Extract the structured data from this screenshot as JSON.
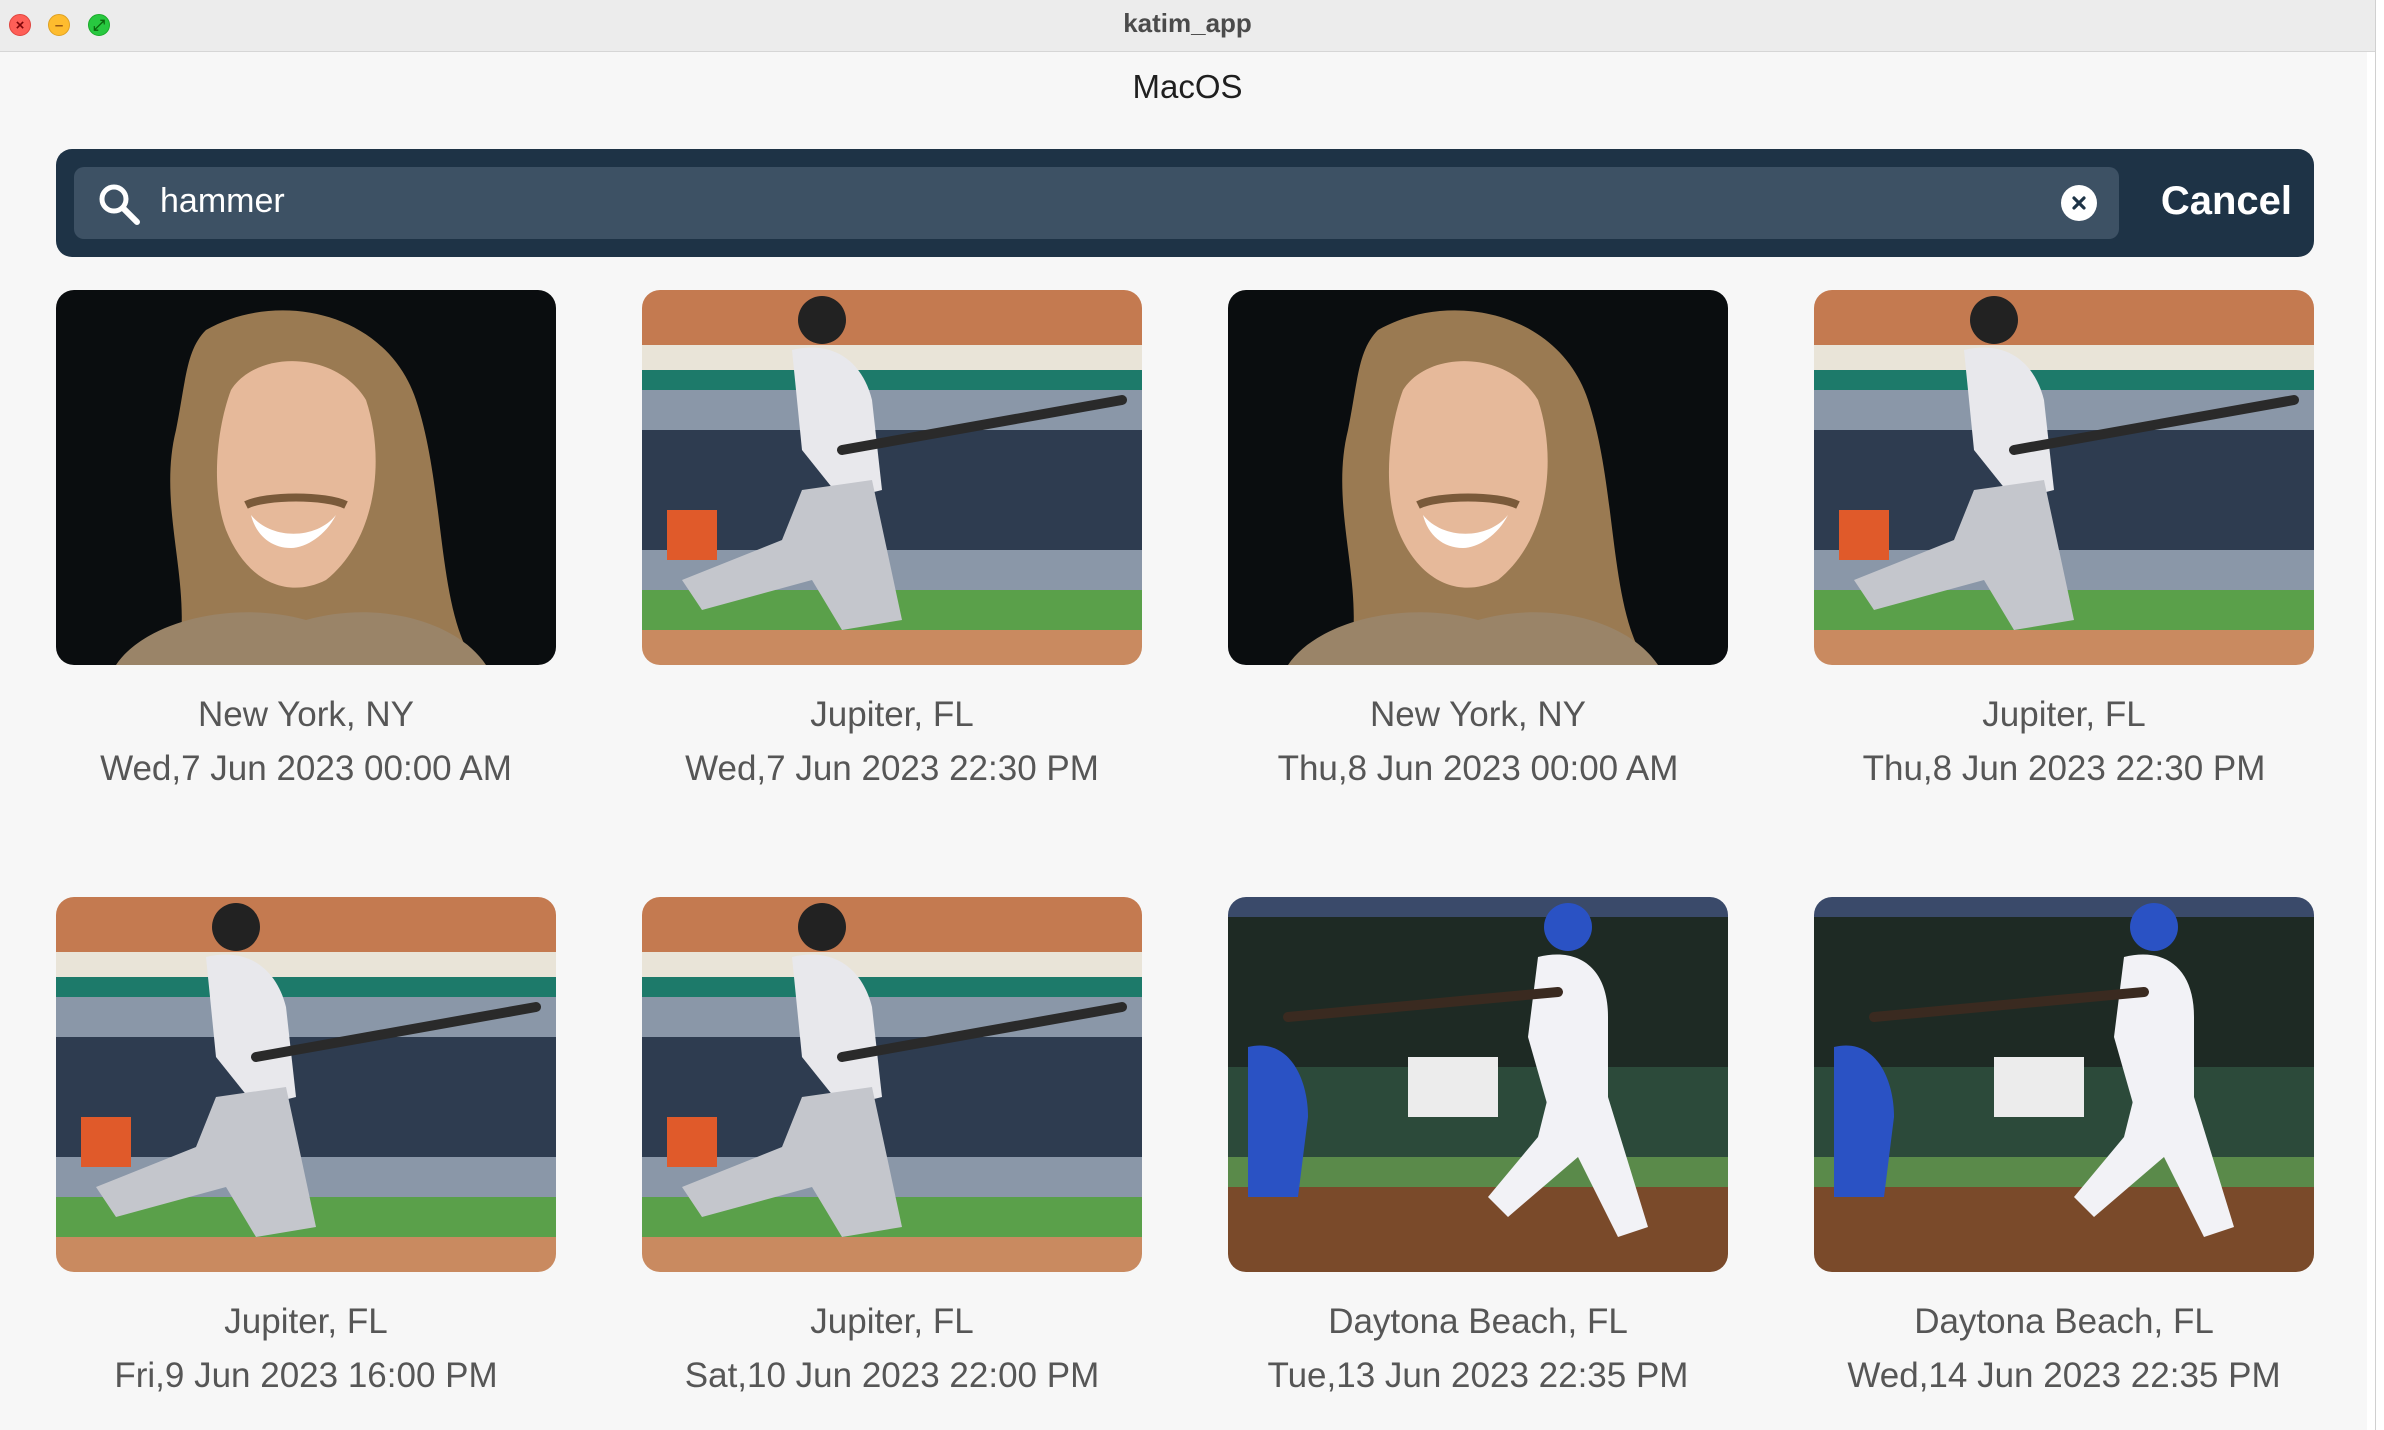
{
  "window": {
    "title": "katim_app",
    "controls": {
      "close_glyph": "×",
      "min_glyph": "–",
      "max_glyph": "⤢"
    }
  },
  "header": {
    "title": "MacOS"
  },
  "search": {
    "value": "hammer",
    "placeholder": "Search",
    "cancel_label": "Cancel"
  },
  "colors": {
    "search_bar_bg": "#1e3346",
    "search_field_bg": "#3d5164",
    "text_secondary": "#565656"
  },
  "results": [
    {
      "image": "portrait-long-hair-man",
      "location": "New York, NY",
      "date": "Wed,7 Jun 2023 00:00 AM"
    },
    {
      "image": "baseball-batter-jupiter",
      "location": "Jupiter, FL",
      "date": "Wed,7 Jun 2023 22:30 PM"
    },
    {
      "image": "portrait-long-hair-man",
      "location": "New York, NY",
      "date": "Thu,8 Jun 2023 00:00 AM"
    },
    {
      "image": "baseball-batter-jupiter",
      "location": "Jupiter, FL",
      "date": "Thu,8 Jun 2023 22:30 PM"
    },
    {
      "image": "baseball-batter-jupiter",
      "location": "Jupiter, FL",
      "date": "Fri,9 Jun 2023 16:00 PM"
    },
    {
      "image": "baseball-batter-jupiter",
      "location": "Jupiter, FL",
      "date": "Sat,10 Jun 2023 22:00 PM"
    },
    {
      "image": "baseball-batter-cubs",
      "location": "Daytona Beach, FL",
      "date": "Tue,13 Jun 2023 22:35 PM"
    },
    {
      "image": "baseball-batter-cubs",
      "location": "Daytona Beach, FL",
      "date": "Wed,14 Jun 2023 22:35 PM"
    }
  ]
}
